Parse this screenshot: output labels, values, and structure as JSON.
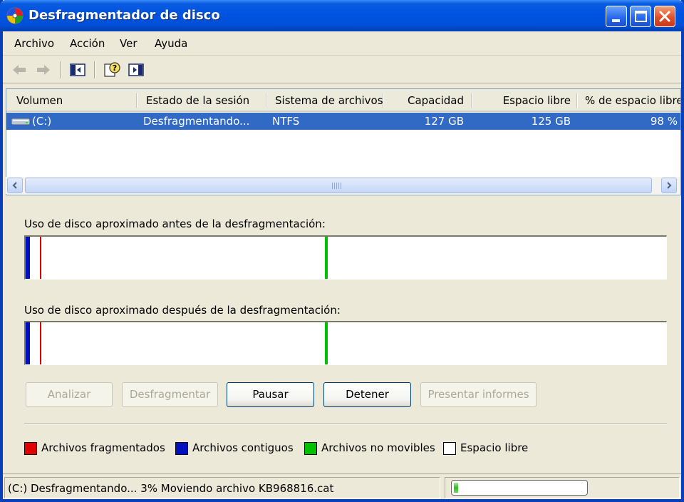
{
  "window": {
    "title": "Desfragmentador de disco"
  },
  "menu": {
    "items": [
      "Archivo",
      "Acción",
      "Ver",
      "Ayuda"
    ]
  },
  "toolbar": {
    "icons": [
      "back-arrow-icon",
      "forward-arrow-icon",
      "show-hide-console-tree-icon",
      "help-icon",
      "show-hide-action-pane-icon"
    ]
  },
  "volumes": {
    "columns": [
      "Volumen",
      "Estado de la sesión",
      "Sistema de archivos",
      "Capacidad",
      "Espacio libre",
      "% de espacio libre"
    ],
    "rows": [
      {
        "volume": "(C:)",
        "session_state": "Desfragmentando...",
        "file_system": "NTFS",
        "capacity": "127 GB",
        "free_space": "125 GB",
        "free_percent": "98 %"
      }
    ]
  },
  "analysis": {
    "before_label": "Uso de disco aproximado antes de la desfragmentación:",
    "after_label": "Uso de disco aproximado después de la desfragmentación:"
  },
  "buttons": {
    "analyze": "Analizar",
    "defragment": "Desfragmentar",
    "pause": "Pausar",
    "stop": "Detener",
    "reports": "Presentar informes"
  },
  "legend": [
    {
      "label": "Archivos fragmentados",
      "color": "#e00000"
    },
    {
      "label": "Archivos contiguos",
      "color": "#0010c0"
    },
    {
      "label": "Archivos no movibles",
      "color": "#00c000"
    },
    {
      "label": "Espacio libre",
      "color": "#ffffff"
    }
  ],
  "status": {
    "text": "(C:) Desfragmentando... 3%  Moviendo archivo KB968816.cat",
    "progress": 0.03
  },
  "colors": {
    "title_bar": "#0053e1",
    "selection": "#316ac5",
    "fragmented": "#e00000",
    "contiguous": "#0010c0",
    "unmovable": "#00c000"
  }
}
